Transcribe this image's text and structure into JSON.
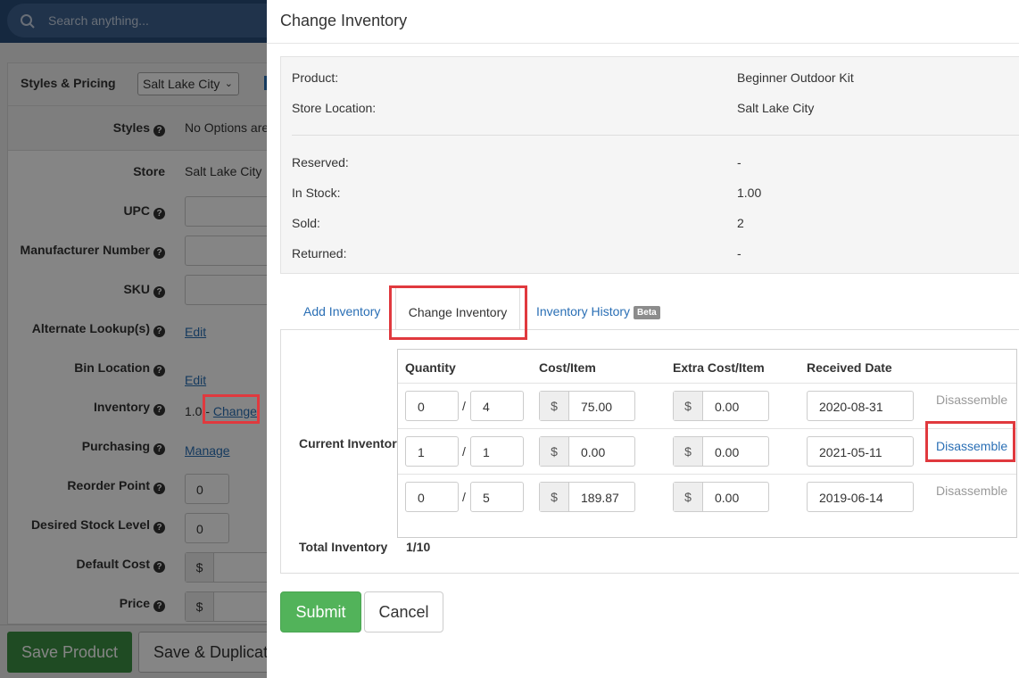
{
  "search": {
    "placeholder": "Search anything..."
  },
  "product_form": {
    "section_title": "Styles & Pricing",
    "location_select": "Salt Lake City",
    "fields": {
      "styles": {
        "label": "Styles",
        "value": "No Options are"
      },
      "store": {
        "label": "Store",
        "value": "Salt Lake City"
      },
      "upc": {
        "label": "UPC"
      },
      "manufacturer_number": {
        "label": "Manufacturer Number"
      },
      "sku": {
        "label": "SKU"
      },
      "alternate_lookups": {
        "label": "Alternate Lookup(s)",
        "link": "Edit"
      },
      "bin_location": {
        "label": "Bin Location",
        "link": "Edit"
      },
      "inventory": {
        "label": "Inventory",
        "value": "1.0 -",
        "link": "Change"
      },
      "purchasing": {
        "label": "Purchasing",
        "link": "Manage"
      },
      "reorder_point": {
        "label": "Reorder Point",
        "value": "0"
      },
      "desired_stock_level": {
        "label": "Desired Stock Level",
        "value": "0"
      },
      "default_cost": {
        "label": "Default Cost",
        "currency": "$"
      },
      "price": {
        "label": "Price",
        "currency": "$"
      }
    },
    "save_product_label": "Save Product",
    "save_duplicate_label": "Save & Duplicate"
  },
  "modal": {
    "title": "Change Inventory",
    "info": {
      "product_label": "Product:",
      "product_value": "Beginner Outdoor Kit",
      "store_label": "Store Location:",
      "store_value": "Salt Lake City",
      "reserved_label": "Reserved:",
      "reserved_value": "-",
      "in_stock_label": "In Stock:",
      "in_stock_value": "1.00",
      "sold_label": "Sold:",
      "sold_value": "2",
      "returned_label": "Returned:",
      "returned_value": "-"
    },
    "tabs": {
      "add": "Add Inventory",
      "change": "Change Inventory",
      "history": "Inventory History",
      "history_badge": "Beta"
    },
    "current_inventory_label": "Current Inventory",
    "table": {
      "headers": {
        "quantity": "Quantity",
        "cost": "Cost/Item",
        "extra": "Extra Cost/Item",
        "received": "Received Date"
      },
      "rows": [
        {
          "qty": "0",
          "of": "4",
          "cost": "75.00",
          "extra": "0.00",
          "date": "2020-08-31",
          "action": "Disassemble"
        },
        {
          "qty": "1",
          "of": "1",
          "cost": "0.00",
          "extra": "0.00",
          "date": "2021-05-11",
          "action": "Disassemble"
        },
        {
          "qty": "0",
          "of": "5",
          "cost": "189.87",
          "extra": "0.00",
          "date": "2019-06-14",
          "action": "Disassemble"
        }
      ],
      "currency": "$",
      "slash": "/"
    },
    "total_label": "Total Inventory",
    "total_value": "1/10",
    "submit_label": "Submit",
    "cancel_label": "Cancel"
  },
  "colors": {
    "primary_link": "#2a6fb5",
    "submit_green": "#52b35a",
    "highlight_red": "#e0393e",
    "topbar": "#2a4e79"
  }
}
